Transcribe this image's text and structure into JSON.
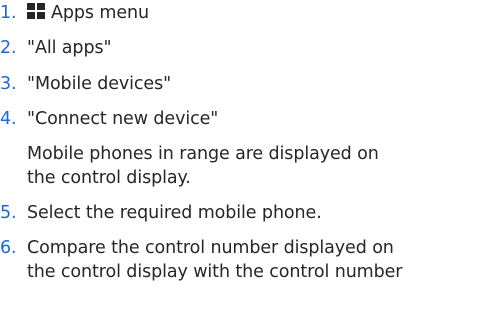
{
  "steps": [
    {
      "number": "1.",
      "icon": "apps-grid-icon",
      "text": "Apps menu"
    },
    {
      "number": "2.",
      "text": "\"All apps\""
    },
    {
      "number": "3.",
      "text": "\"Mobile devices\""
    },
    {
      "number": "4.",
      "text": "\"Connect new device\""
    },
    {
      "number": "5.",
      "text": "Select the required mobile phone."
    },
    {
      "number": "6.",
      "text_line1": "Compare the control number displayed on",
      "text_line2": "the control display with the control number"
    }
  ],
  "note": {
    "line1": "Mobile phones in range are displayed on",
    "line2": "the control display."
  },
  "colors": {
    "step_number": "#1c69d4",
    "text": "#262626"
  }
}
